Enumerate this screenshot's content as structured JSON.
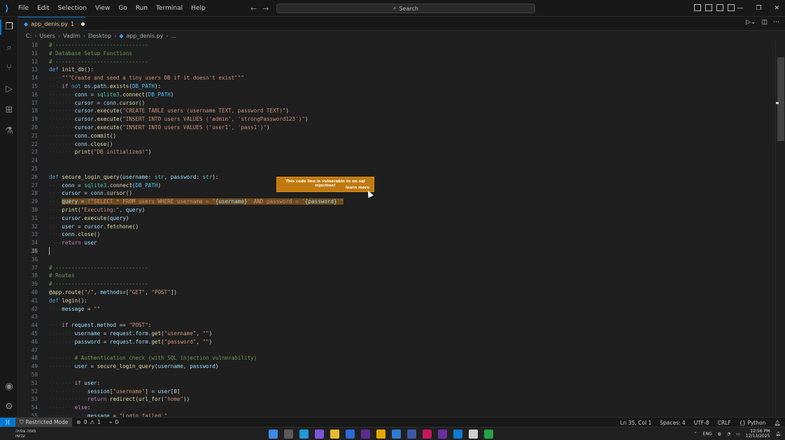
{
  "titlebar": {
    "menu": [
      "File",
      "Edit",
      "Selection",
      "View",
      "Go",
      "Run",
      "Terminal",
      "Help"
    ],
    "search_label": "Search"
  },
  "tab": {
    "label": "app_denis.py",
    "index": "1",
    "modified": true
  },
  "breadcrumb": [
    "C:",
    "Users",
    "Vadim",
    "Desktop",
    "app_denis.py",
    "..."
  ],
  "tooltip": {
    "message": "This code line is vulnerable to an sql injection!",
    "link": "learn more"
  },
  "editor": {
    "current_line": 35,
    "highlight_line": 29,
    "lines": [
      {
        "n": "10",
        "tokens": [
          [
            "cm",
            "# -----------------------------"
          ]
        ]
      },
      {
        "n": "11",
        "tokens": [
          [
            "cm",
            "# Database Setup Functions"
          ]
        ]
      },
      {
        "n": "12",
        "tokens": [
          [
            "cm",
            "# -----------------------------"
          ]
        ]
      },
      {
        "n": "13",
        "tokens": [
          [
            "kw",
            "def "
          ],
          [
            "fn",
            "init_db"
          ],
          [
            "pl",
            "():"
          ]
        ]
      },
      {
        "n": "14",
        "tokens": [
          [
            "ws",
            "····"
          ],
          [
            "str",
            "\"\"\"Create and seed a tiny users DB if it doesn't exist\"\"\""
          ]
        ]
      },
      {
        "n": "15",
        "tokens": [
          [
            "ws",
            "····"
          ],
          [
            "ctl",
            "if "
          ],
          [
            "kw",
            "not "
          ],
          [
            "var",
            "os"
          ],
          [
            "pl",
            "."
          ],
          [
            "var",
            "path"
          ],
          [
            "pl",
            "."
          ],
          [
            "fn",
            "exists"
          ],
          [
            "pl",
            "("
          ],
          [
            "cst",
            "DB_PATH"
          ],
          [
            "pl",
            "):"
          ]
        ]
      },
      {
        "n": "16",
        "tokens": [
          [
            "ws",
            "········"
          ],
          [
            "var",
            "conn"
          ],
          [
            "pl",
            " = "
          ],
          [
            "cls",
            "sqlite3"
          ],
          [
            "pl",
            "."
          ],
          [
            "fn",
            "connect"
          ],
          [
            "pl",
            "("
          ],
          [
            "cst",
            "DB_PATH"
          ],
          [
            "pl",
            ")"
          ]
        ]
      },
      {
        "n": "17",
        "tokens": [
          [
            "ws",
            "········"
          ],
          [
            "var",
            "cursor"
          ],
          [
            "pl",
            " = "
          ],
          [
            "var",
            "conn"
          ],
          [
            "pl",
            "."
          ],
          [
            "fn",
            "cursor"
          ],
          [
            "pl",
            "()"
          ]
        ]
      },
      {
        "n": "18",
        "tokens": [
          [
            "ws",
            "········"
          ],
          [
            "var",
            "cursor"
          ],
          [
            "pl",
            "."
          ],
          [
            "fn",
            "execute"
          ],
          [
            "pl",
            "("
          ],
          [
            "str",
            "\"CREATE TABLE users (username TEXT, password TEXT)\""
          ],
          [
            "pl",
            ")"
          ]
        ]
      },
      {
        "n": "19",
        "tokens": [
          [
            "ws",
            "········"
          ],
          [
            "var",
            "cursor"
          ],
          [
            "pl",
            "."
          ],
          [
            "fn",
            "execute"
          ],
          [
            "pl",
            "("
          ],
          [
            "str",
            "\"INSERT INTO users VALUES ('admin', 'strongPassword123')\""
          ],
          [
            "pl",
            ")"
          ]
        ]
      },
      {
        "n": "20",
        "tokens": [
          [
            "ws",
            "········"
          ],
          [
            "var",
            "cursor"
          ],
          [
            "pl",
            "."
          ],
          [
            "fn",
            "execute"
          ],
          [
            "pl",
            "("
          ],
          [
            "str",
            "\"INSERT INTO users VALUES ('user1', 'pass1')\""
          ],
          [
            "pl",
            ")"
          ]
        ]
      },
      {
        "n": "21",
        "tokens": [
          [
            "ws",
            "········"
          ],
          [
            "var",
            "conn"
          ],
          [
            "pl",
            "."
          ],
          [
            "fn",
            "commit"
          ],
          [
            "pl",
            "()"
          ]
        ]
      },
      {
        "n": "22",
        "tokens": [
          [
            "ws",
            "········"
          ],
          [
            "var",
            "conn"
          ],
          [
            "pl",
            "."
          ],
          [
            "fn",
            "close"
          ],
          [
            "pl",
            "()"
          ]
        ]
      },
      {
        "n": "23",
        "tokens": [
          [
            "ws",
            "········"
          ],
          [
            "fn",
            "print"
          ],
          [
            "pl",
            "("
          ],
          [
            "str",
            "\"DB initialized!\""
          ],
          [
            "pl",
            ")"
          ]
        ]
      },
      {
        "n": "24",
        "tokens": []
      },
      {
        "n": "25",
        "tokens": []
      },
      {
        "n": "26",
        "tokens": [
          [
            "kw",
            "def "
          ],
          [
            "fn",
            "secure_login_query"
          ],
          [
            "pl",
            "("
          ],
          [
            "var",
            "username"
          ],
          [
            "pl",
            ": "
          ],
          [
            "cls",
            "str"
          ],
          [
            "pl",
            ", "
          ],
          [
            "var",
            "password"
          ],
          [
            "pl",
            ": "
          ],
          [
            "cls",
            "str"
          ],
          [
            "pl",
            "):"
          ]
        ]
      },
      {
        "n": "27",
        "tokens": [
          [
            "ws",
            "····"
          ],
          [
            "var",
            "conn"
          ],
          [
            "pl",
            " = "
          ],
          [
            "cls",
            "sqlite3"
          ],
          [
            "pl",
            "."
          ],
          [
            "fn",
            "connect"
          ],
          [
            "pl",
            "("
          ],
          [
            "cst",
            "DB_PATH"
          ],
          [
            "pl",
            ")"
          ]
        ]
      },
      {
        "n": "28",
        "tokens": [
          [
            "ws",
            "····"
          ],
          [
            "var",
            "cursor"
          ],
          [
            "pl",
            " = "
          ],
          [
            "var",
            "conn"
          ],
          [
            "pl",
            "."
          ],
          [
            "fn",
            "cursor"
          ],
          [
            "pl",
            "()"
          ]
        ]
      },
      {
        "n": "29",
        "tokens": [
          [
            "ws",
            "····"
          ],
          [
            "var",
            "query"
          ],
          [
            "pl",
            " = "
          ],
          [
            "kw",
            "f"
          ],
          [
            "str",
            "\"SELECT * FROM users WHERE username = '"
          ],
          [
            "pl",
            "{"
          ],
          [
            "var",
            "username"
          ],
          [
            "pl",
            "}"
          ],
          [
            "str",
            "' AND password = '"
          ],
          [
            "pl",
            "{"
          ],
          [
            "var",
            "password"
          ],
          [
            "pl",
            "}"
          ],
          [
            "str",
            "'\""
          ]
        ]
      },
      {
        "n": "30",
        "tokens": [
          [
            "ws",
            "····"
          ],
          [
            "fn",
            "print"
          ],
          [
            "pl",
            "("
          ],
          [
            "str",
            "\"Executing:\""
          ],
          [
            "pl",
            ", "
          ],
          [
            "var",
            "query"
          ],
          [
            "pl",
            ")"
          ]
        ]
      },
      {
        "n": "31",
        "tokens": [
          [
            "ws",
            "····"
          ],
          [
            "var",
            "cursor"
          ],
          [
            "pl",
            "."
          ],
          [
            "fn",
            "execute"
          ],
          [
            "pl",
            "("
          ],
          [
            "var",
            "query"
          ],
          [
            "pl",
            ")"
          ]
        ]
      },
      {
        "n": "32",
        "tokens": [
          [
            "ws",
            "····"
          ],
          [
            "var",
            "user"
          ],
          [
            "pl",
            " = "
          ],
          [
            "var",
            "cursor"
          ],
          [
            "pl",
            "."
          ],
          [
            "fn",
            "fetchone"
          ],
          [
            "pl",
            "()"
          ]
        ]
      },
      {
        "n": "33",
        "tokens": [
          [
            "ws",
            "····"
          ],
          [
            "var",
            "conn"
          ],
          [
            "pl",
            "."
          ],
          [
            "fn",
            "close"
          ],
          [
            "pl",
            "()"
          ]
        ]
      },
      {
        "n": "34",
        "tokens": [
          [
            "ws",
            "····"
          ],
          [
            "ctl",
            "return "
          ],
          [
            "var",
            "user"
          ]
        ]
      },
      {
        "n": "35",
        "tokens": []
      },
      {
        "n": "36",
        "tokens": []
      },
      {
        "n": "37",
        "tokens": [
          [
            "cm",
            "# -----------------------------"
          ]
        ]
      },
      {
        "n": "38",
        "tokens": [
          [
            "cm",
            "# Routes"
          ]
        ]
      },
      {
        "n": "39",
        "tokens": [
          [
            "cm",
            "# -----------------------------"
          ]
        ]
      },
      {
        "n": "40",
        "tokens": [
          [
            "dec",
            "@app"
          ],
          [
            "pl",
            "."
          ],
          [
            "fn",
            "route"
          ],
          [
            "pl",
            "("
          ],
          [
            "str",
            "\"/\""
          ],
          [
            "pl",
            ", "
          ],
          [
            "var",
            "methods"
          ],
          [
            "pl",
            "=["
          ],
          [
            "str",
            "\"GET\""
          ],
          [
            "pl",
            ", "
          ],
          [
            "str",
            "\"POST\""
          ],
          [
            "pl",
            "])"
          ]
        ]
      },
      {
        "n": "41",
        "tokens": [
          [
            "kw",
            "def "
          ],
          [
            "fn",
            "login"
          ],
          [
            "pl",
            "():"
          ]
        ]
      },
      {
        "n": "42",
        "tokens": [
          [
            "ws",
            "····"
          ],
          [
            "var",
            "message"
          ],
          [
            "pl",
            " = "
          ],
          [
            "str",
            "\"\""
          ]
        ]
      },
      {
        "n": "43",
        "tokens": []
      },
      {
        "n": "44",
        "tokens": [
          [
            "ws",
            "····"
          ],
          [
            "ctl",
            "if "
          ],
          [
            "var",
            "request"
          ],
          [
            "pl",
            "."
          ],
          [
            "var",
            "method"
          ],
          [
            "pl",
            " == "
          ],
          [
            "str",
            "\"POST\""
          ],
          [
            "pl",
            ":"
          ]
        ]
      },
      {
        "n": "45",
        "tokens": [
          [
            "ws",
            "········"
          ],
          [
            "var",
            "username"
          ],
          [
            "pl",
            " = "
          ],
          [
            "var",
            "request"
          ],
          [
            "pl",
            "."
          ],
          [
            "var",
            "form"
          ],
          [
            "pl",
            "."
          ],
          [
            "fn",
            "get"
          ],
          [
            "pl",
            "("
          ],
          [
            "str",
            "\"username\""
          ],
          [
            "pl",
            ", "
          ],
          [
            "str",
            "\"\""
          ],
          [
            "pl",
            ")"
          ]
        ]
      },
      {
        "n": "46",
        "tokens": [
          [
            "ws",
            "········"
          ],
          [
            "var",
            "password"
          ],
          [
            "pl",
            " = "
          ],
          [
            "var",
            "request"
          ],
          [
            "pl",
            "."
          ],
          [
            "var",
            "form"
          ],
          [
            "pl",
            "."
          ],
          [
            "fn",
            "get"
          ],
          [
            "pl",
            "("
          ],
          [
            "str",
            "\"password\""
          ],
          [
            "pl",
            ", "
          ],
          [
            "str",
            "\"\""
          ],
          [
            "pl",
            ")"
          ]
        ]
      },
      {
        "n": "47",
        "tokens": []
      },
      {
        "n": "48",
        "tokens": [
          [
            "ws",
            "········"
          ],
          [
            "cm",
            "# Authentication check (with SQL injection vulnerability)"
          ]
        ]
      },
      {
        "n": "49",
        "tokens": [
          [
            "ws",
            "········"
          ],
          [
            "var",
            "user"
          ],
          [
            "pl",
            " = "
          ],
          [
            "fn",
            "secure_login_query"
          ],
          [
            "pl",
            "("
          ],
          [
            "var",
            "username"
          ],
          [
            "pl",
            ", "
          ],
          [
            "var",
            "password"
          ],
          [
            "pl",
            ")"
          ]
        ]
      },
      {
        "n": "50",
        "tokens": []
      },
      {
        "n": "51",
        "tokens": [
          [
            "ws",
            "········"
          ],
          [
            "ctl",
            "if "
          ],
          [
            "var",
            "user"
          ],
          [
            "pl",
            ":"
          ]
        ]
      },
      {
        "n": "52",
        "tokens": [
          [
            "ws",
            "············"
          ],
          [
            "var",
            "session"
          ],
          [
            "pl",
            "["
          ],
          [
            "str",
            "\"username\""
          ],
          [
            "pl",
            "] = "
          ],
          [
            "var",
            "user"
          ],
          [
            "pl",
            "[0]"
          ]
        ]
      },
      {
        "n": "53",
        "tokens": [
          [
            "ws",
            "············"
          ],
          [
            "ctl",
            "return "
          ],
          [
            "fn",
            "redirect"
          ],
          [
            "pl",
            "("
          ],
          [
            "fn",
            "url_for"
          ],
          [
            "pl",
            "("
          ],
          [
            "str",
            "\"home\""
          ],
          [
            "pl",
            "))"
          ]
        ]
      },
      {
        "n": "54",
        "tokens": [
          [
            "ws",
            "········"
          ],
          [
            "ctl",
            "else"
          ],
          [
            "pl",
            ":"
          ]
        ]
      },
      {
        "n": "55",
        "tokens": [
          [
            "ws",
            "············"
          ],
          [
            "var",
            "message"
          ],
          [
            "pl",
            " = "
          ],
          [
            "str",
            "\"Login failed.\""
          ]
        ]
      }
    ]
  },
  "statusbar": {
    "restricted": "Restricted Mode",
    "errors": "0",
    "warnings": "1",
    "ports": "0",
    "position": "Ln 35, Col 1",
    "spaces": "Spaces: 4",
    "encoding": "UTF-8",
    "eol": "CRLF",
    "language": "Python"
  },
  "taskbar": {
    "weather_line1": "סופה צפויה",
    "weather_line2": "עכשיו",
    "lang": "ENG",
    "time": "12:56 PM",
    "date": "12/13/2025"
  },
  "colors": {
    "accent": "#0078d4",
    "tooltip_bg": "#c07a0e",
    "highlight_bg": "#6b4a1c"
  }
}
